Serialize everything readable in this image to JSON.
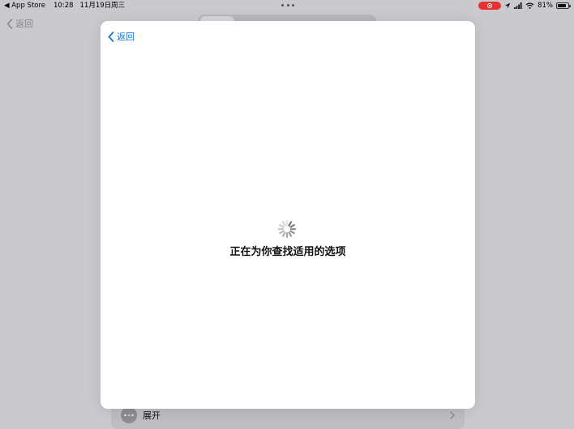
{
  "status_bar": {
    "back_app": "◀ App Store",
    "time": "10:28",
    "date": "11月19日周三",
    "battery_pct": "81%",
    "battery_level": 0.81
  },
  "background": {
    "back_label": "返回",
    "segments": [
      {
        "label": "",
        "selected": true
      },
      {
        "label": ""
      },
      {
        "label": ""
      },
      {
        "label": ""
      }
    ],
    "row_label": "展开"
  },
  "modal": {
    "back_label": "返回",
    "loading_text": "正在为你查找适用的选项"
  },
  "colors": {
    "accent": "#1a73e8",
    "record": "#e8312f",
    "page_bg": "#c9c9ce"
  },
  "icons": {
    "modal_back": "chevron-left-icon",
    "spinner": "activity-spinner-icon",
    "more": "ellipsis-icon",
    "row_chevron": "chevron-right-icon"
  }
}
